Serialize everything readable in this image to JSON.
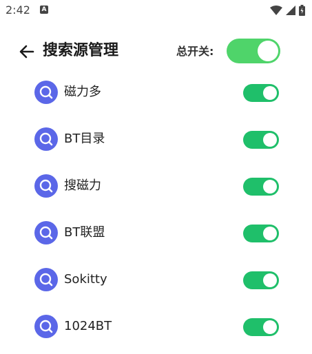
{
  "status_bar": {
    "time": "2:42",
    "notification_icon": "app-notification-icon",
    "notification_letter": "A",
    "icons": [
      "wifi-icon",
      "signal-icon",
      "battery-icon"
    ]
  },
  "header": {
    "back_icon": "arrow-left-icon",
    "title": "搜索源管理",
    "master_switch_label": "总开关:",
    "master_switch_on": true
  },
  "sources": [
    {
      "label": "磁力多",
      "enabled": true
    },
    {
      "label": "BT目录",
      "enabled": true
    },
    {
      "label": "搜磁力",
      "enabled": true
    },
    {
      "label": "BT联盟",
      "enabled": true
    },
    {
      "label": "Sokitty",
      "enabled": true
    },
    {
      "label": "1024BT",
      "enabled": true
    }
  ],
  "colors": {
    "master_toggle_on": "#4fd46a",
    "item_toggle_on": "#1fbf6a",
    "source_icon_bg": "#5b67e8",
    "title_text": "#1a1a1a"
  }
}
